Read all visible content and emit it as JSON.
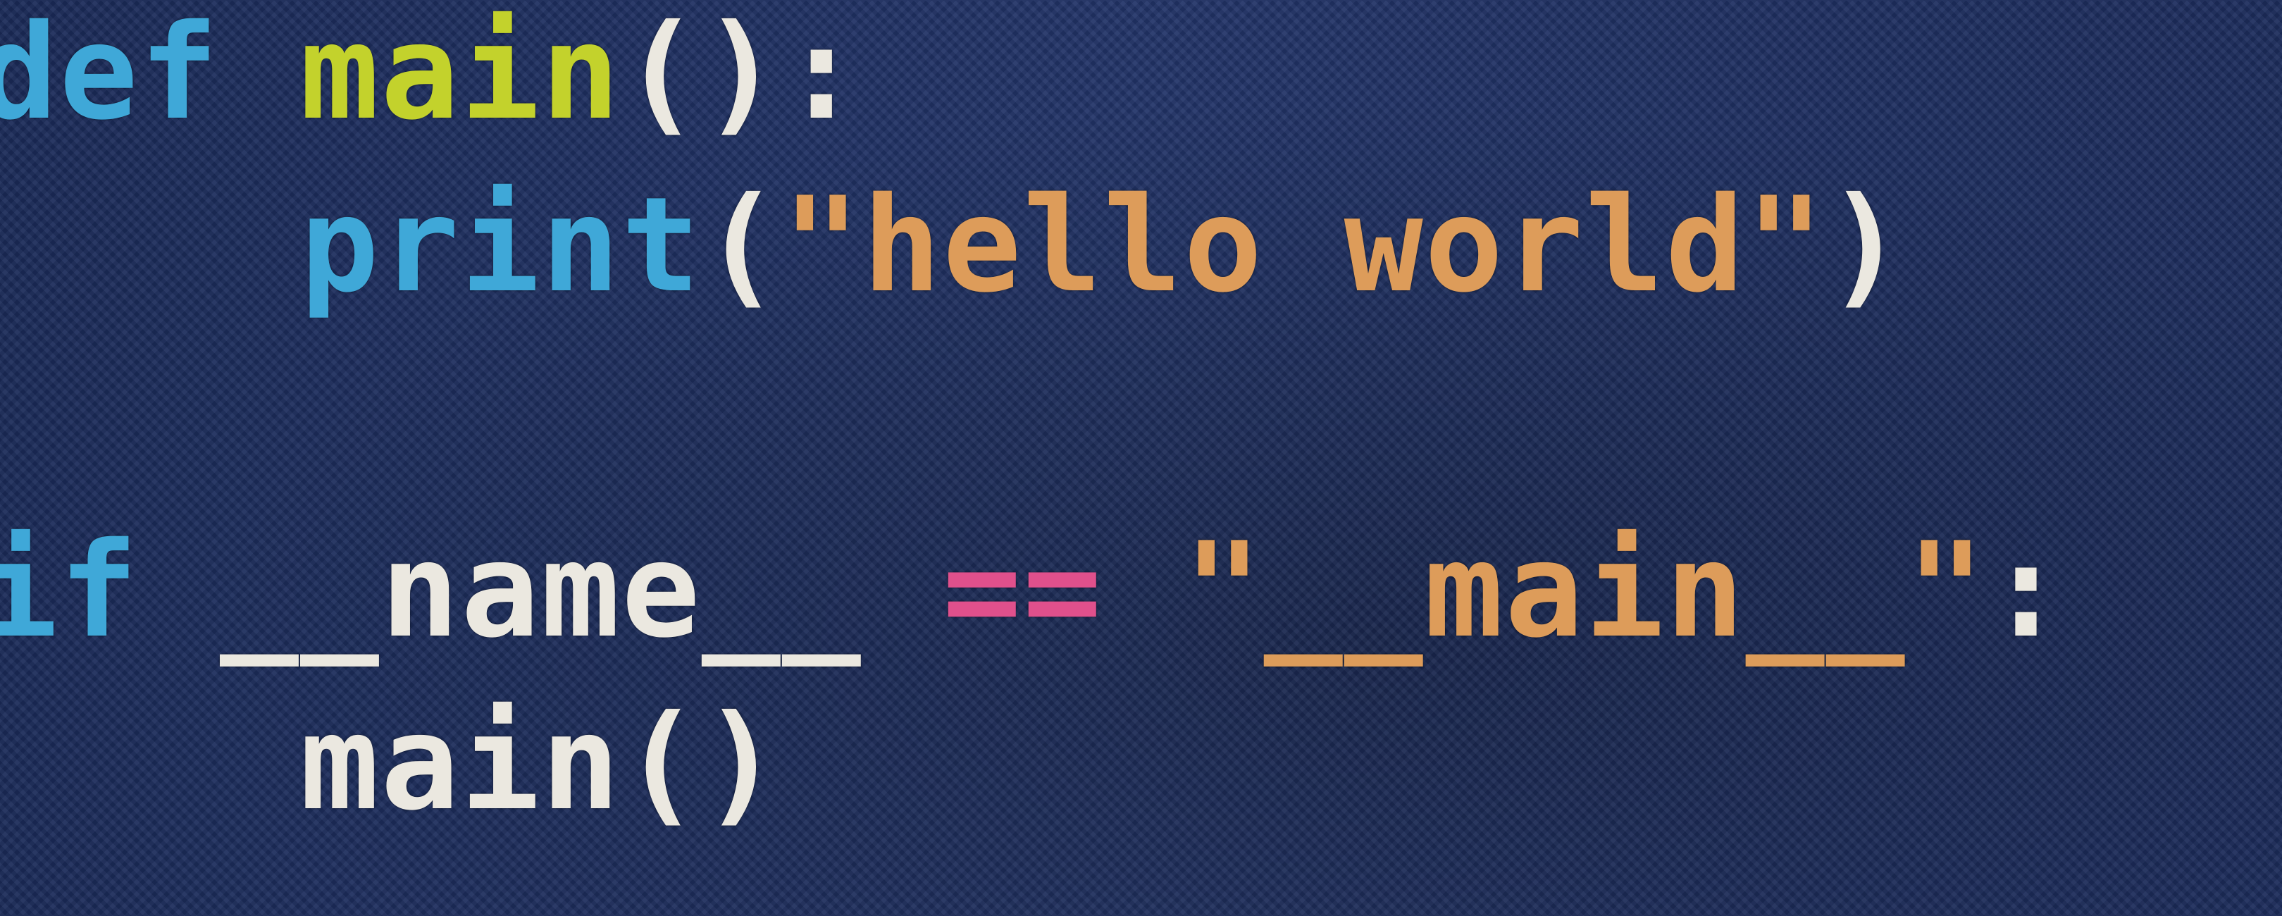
{
  "code": {
    "line1": {
      "kw": "def",
      "fn": "main",
      "rest": "():"
    },
    "line2": {
      "indent": "    ",
      "kw": "print",
      "open": "(",
      "str": "\"hello world\"",
      "close": ")"
    },
    "line3": "",
    "line4": {
      "kw": "if",
      "id": "__name__",
      "op": "==",
      "str": "\"__main__\"",
      "colon": ":"
    },
    "line5": {
      "indent": "    ",
      "call": "main()"
    }
  },
  "colors": {
    "background": "#1d2d5c",
    "keyword": "#3fa8d8",
    "function": "#c3d22c",
    "punctuation": "#ebe8e0",
    "string": "#dd9c5a",
    "operator": "#e0508c"
  }
}
